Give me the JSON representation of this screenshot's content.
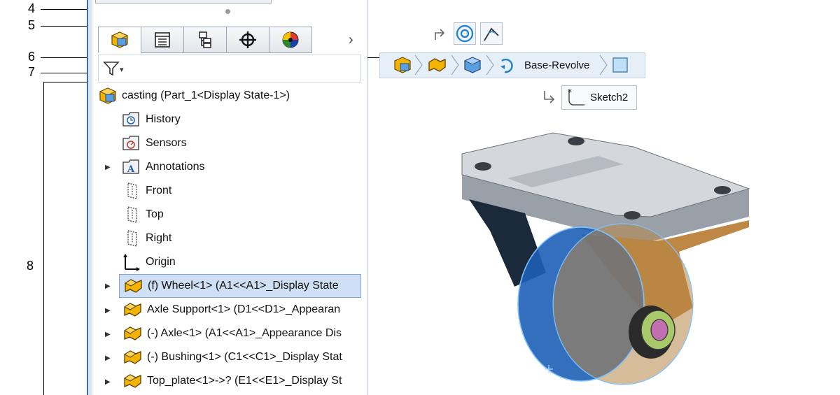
{
  "callouts": [
    "4",
    "5",
    "6",
    "7",
    "8"
  ],
  "tabs": [
    {
      "name": "feature-manager",
      "icon": "part-icon"
    },
    {
      "name": "property-manager",
      "icon": "property-list-icon"
    },
    {
      "name": "configuration-manager",
      "icon": "configuration-icon"
    },
    {
      "name": "dimxpert-manager",
      "icon": "crosshair-icon"
    },
    {
      "name": "display-manager",
      "icon": "appearance-sphere-icon"
    }
  ],
  "tabs_more": "›",
  "filter": {
    "icon": "funnel-icon",
    "dropdown": "▾"
  },
  "tree": {
    "root": "casting  (Part_1<Display State-1>)",
    "items": [
      {
        "label": "History",
        "icon": "history-folder-icon",
        "expandable": false
      },
      {
        "label": "Sensors",
        "icon": "sensors-folder-icon",
        "expandable": false
      },
      {
        "label": "Annotations",
        "icon": "annotations-folder-icon",
        "expandable": true
      },
      {
        "label": "Front",
        "icon": "plane-icon",
        "expandable": false
      },
      {
        "label": "Top",
        "icon": "plane-icon",
        "expandable": false
      },
      {
        "label": "Right",
        "icon": "plane-icon",
        "expandable": false
      },
      {
        "label": "Origin",
        "icon": "origin-icon",
        "expandable": false
      },
      {
        "label": "(f) Wheel<1> (A1<<A1>_Display State",
        "icon": "component-icon",
        "expandable": true,
        "selected": true
      },
      {
        "label": "Axle Support<1> (D1<<D1>_Appearan",
        "icon": "component-icon",
        "expandable": true
      },
      {
        "label": "(-) Axle<1> (A1<<A1>_Appearance Dis",
        "icon": "component-icon",
        "expandable": true
      },
      {
        "label": "(-) Bushing<1> (C1<<C1>_Display Stat",
        "icon": "component-icon",
        "expandable": true
      },
      {
        "label": "Top_plate<1>->? (E1<<E1>_Display St",
        "icon": "component-icon",
        "expandable": true
      }
    ]
  },
  "breadcrumb": {
    "label": "Base-Revolve",
    "icons": [
      "part-icon",
      "component-icon",
      "body-icon",
      "revolve-icon",
      "face-icon"
    ]
  },
  "context_toolbar": {
    "icons": [
      "arrow-up-right-icon",
      "concentric-icon",
      "angle-icon"
    ]
  },
  "sketch": {
    "label": "Sketch2",
    "icon": "sketch-icon",
    "arrow": "arrow-down-right-icon"
  },
  "colors": {
    "accent": "#3c6fae",
    "selection": "#cfe0f5",
    "component": "#f2b400",
    "wheel": "#1d5fb6"
  }
}
